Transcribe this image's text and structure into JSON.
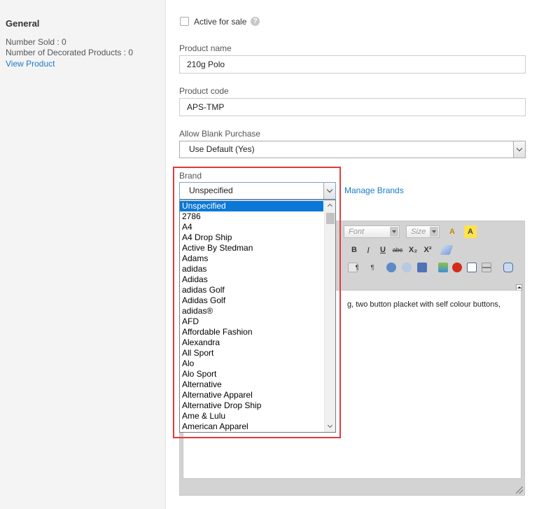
{
  "sidebar": {
    "title": "General",
    "number_sold": "Number Sold : 0",
    "decorated_products": "Number of Decorated Products : 0",
    "view_product": "View Product"
  },
  "form": {
    "active_for_sale_label": "Active for sale",
    "help_glyph": "?",
    "product_name_label": "Product name",
    "product_name_value": "210g Polo",
    "product_code_label": "Product code",
    "product_code_value": "APS-TMP",
    "allow_blank_label": "Allow Blank Purchase",
    "allow_blank_value": "Use Default (Yes)",
    "brand_label": "Brand",
    "brand_value": "Unspecified",
    "manage_brands": "Manage Brands"
  },
  "brand_options": [
    "Unspecified",
    "2786",
    "A4",
    "A4 Drop Ship",
    "Active By Stedman",
    "Adams",
    "adidas",
    "Adidas",
    "adidas Golf",
    "Adidas Golf",
    "adidas®",
    "AFD",
    "Affordable Fashion",
    "Alexandra",
    "All Sport",
    "Alo",
    "Alo Sport",
    "Alternative",
    "Alternative Apparel",
    "Alternative Drop Ship",
    "Ame & Lulu",
    "American Apparel"
  ],
  "editor": {
    "font_placeholder": "Font",
    "size_placeholder": "Size",
    "description_fragment": "g, two button placket with self colour buttons,",
    "bold": "B",
    "italic": "I",
    "underline": "U",
    "strike": "abc",
    "subscript": "X₂",
    "superscript": "X²",
    "text_color_glyph": "A",
    "bg_color_glyph": "A"
  },
  "colors": {
    "link": "#1a7bc9",
    "selected_option": "#0a78d7",
    "highlight_box": "#e23b3b"
  }
}
